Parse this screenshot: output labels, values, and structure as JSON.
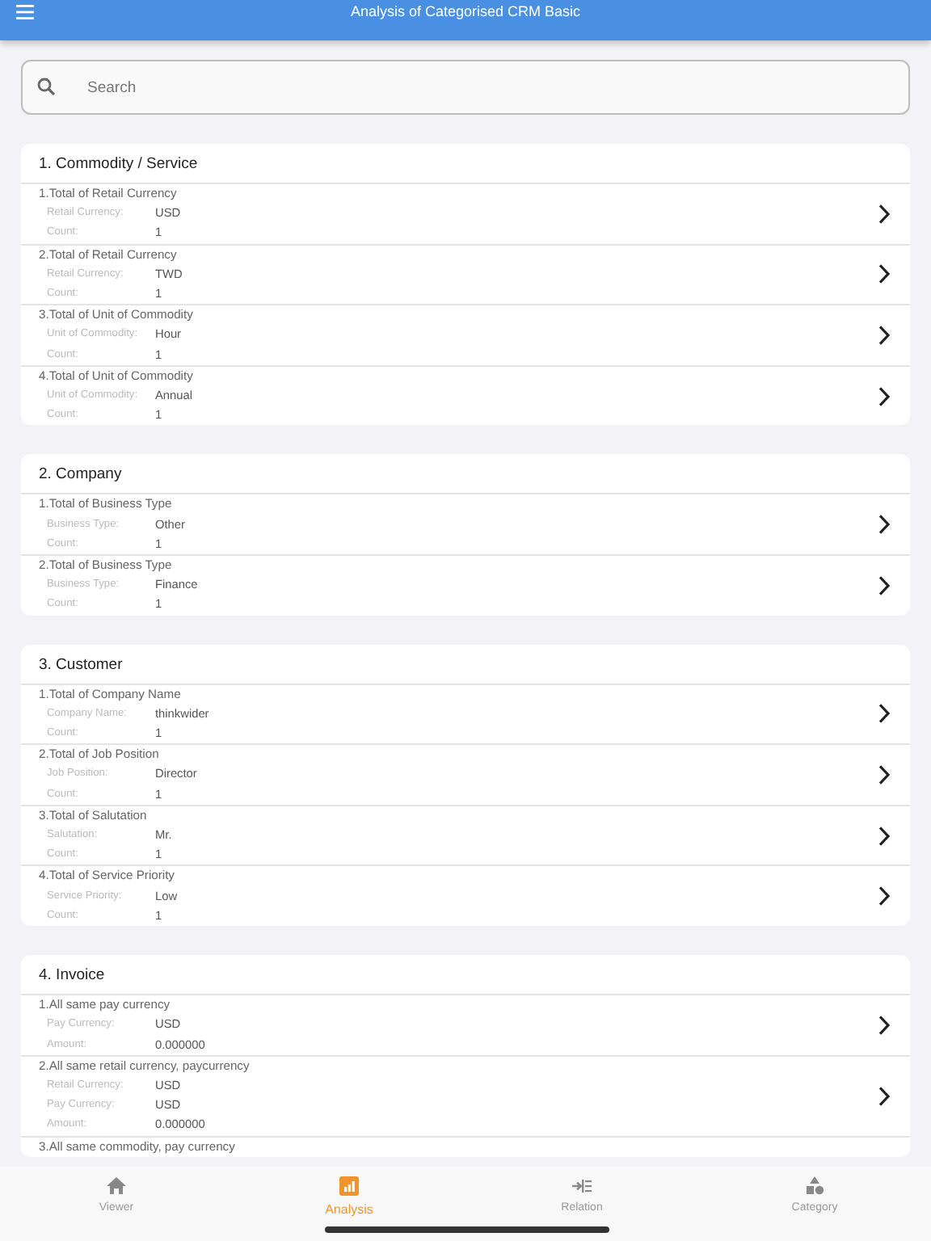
{
  "app_bar": {
    "title": "Analysis of Categorised CRM Basic"
  },
  "search": {
    "placeholder": "Search"
  },
  "sections": [
    {
      "title": "1. Commodity / Service",
      "rows": [
        {
          "title": "1.Total of Retail Currency",
          "fields": [
            {
              "label": "Retail Currency:",
              "value": "USD"
            },
            {
              "label": "Count:",
              "value": "1"
            }
          ]
        },
        {
          "title": "2.Total of Retail Currency",
          "fields": [
            {
              "label": "Retail Currency:",
              "value": "TWD"
            },
            {
              "label": "Count:",
              "value": "1"
            }
          ]
        },
        {
          "title": "3.Total of Unit of Commodity",
          "fields": [
            {
              "label": "Unit of Commodity:",
              "value": "Hour"
            },
            {
              "label": "Count:",
              "value": "1"
            }
          ]
        },
        {
          "title": "4.Total of Unit of Commodity",
          "fields": [
            {
              "label": "Unit of Commodity:",
              "value": "Annual"
            },
            {
              "label": "Count:",
              "value": "1"
            }
          ]
        }
      ]
    },
    {
      "title": "2. Company",
      "rows": [
        {
          "title": "1.Total of Business Type",
          "fields": [
            {
              "label": "Business Type:",
              "value": "Other"
            },
            {
              "label": "Count:",
              "value": "1"
            }
          ]
        },
        {
          "title": "2.Total of Business Type",
          "fields": [
            {
              "label": "Business Type:",
              "value": "Finance"
            },
            {
              "label": "Count:",
              "value": "1"
            }
          ]
        }
      ]
    },
    {
      "title": "3. Customer",
      "rows": [
        {
          "title": "1.Total of Company Name",
          "fields": [
            {
              "label": "Company Name:",
              "value": "thinkwider"
            },
            {
              "label": "Count:",
              "value": "1"
            }
          ]
        },
        {
          "title": "2.Total of Job Position",
          "fields": [
            {
              "label": "Job Position:",
              "value": "Director"
            },
            {
              "label": "Count:",
              "value": "1"
            }
          ]
        },
        {
          "title": "3.Total of Salutation",
          "fields": [
            {
              "label": "Salutation:",
              "value": "Mr."
            },
            {
              "label": "Count:",
              "value": "1"
            }
          ]
        },
        {
          "title": "4.Total of Service Priority",
          "fields": [
            {
              "label": "Service Priority:",
              "value": "Low"
            },
            {
              "label": "Count:",
              "value": "1"
            }
          ]
        }
      ]
    },
    {
      "title": "4. Invoice",
      "rows": [
        {
          "title": "1.All same pay currency",
          "fields": [
            {
              "label": "Pay Currency:",
              "value": "USD"
            },
            {
              "label": "Amount:",
              "value": "0.000000"
            }
          ]
        },
        {
          "title": "2.All same retail currency, paycurrency",
          "fields": [
            {
              "label": "Retail Currency:",
              "value": "USD"
            },
            {
              "label": "Pay Currency:",
              "value": "USD"
            },
            {
              "label": "Amount:",
              "value": "0.000000"
            }
          ]
        },
        {
          "title": "3.All same commodity, pay currency",
          "fields": []
        }
      ]
    }
  ],
  "tabs": [
    {
      "label": "Viewer",
      "selected": false
    },
    {
      "label": "Analysis",
      "selected": true
    },
    {
      "label": "Relation",
      "selected": false
    },
    {
      "label": "Category",
      "selected": false
    }
  ]
}
